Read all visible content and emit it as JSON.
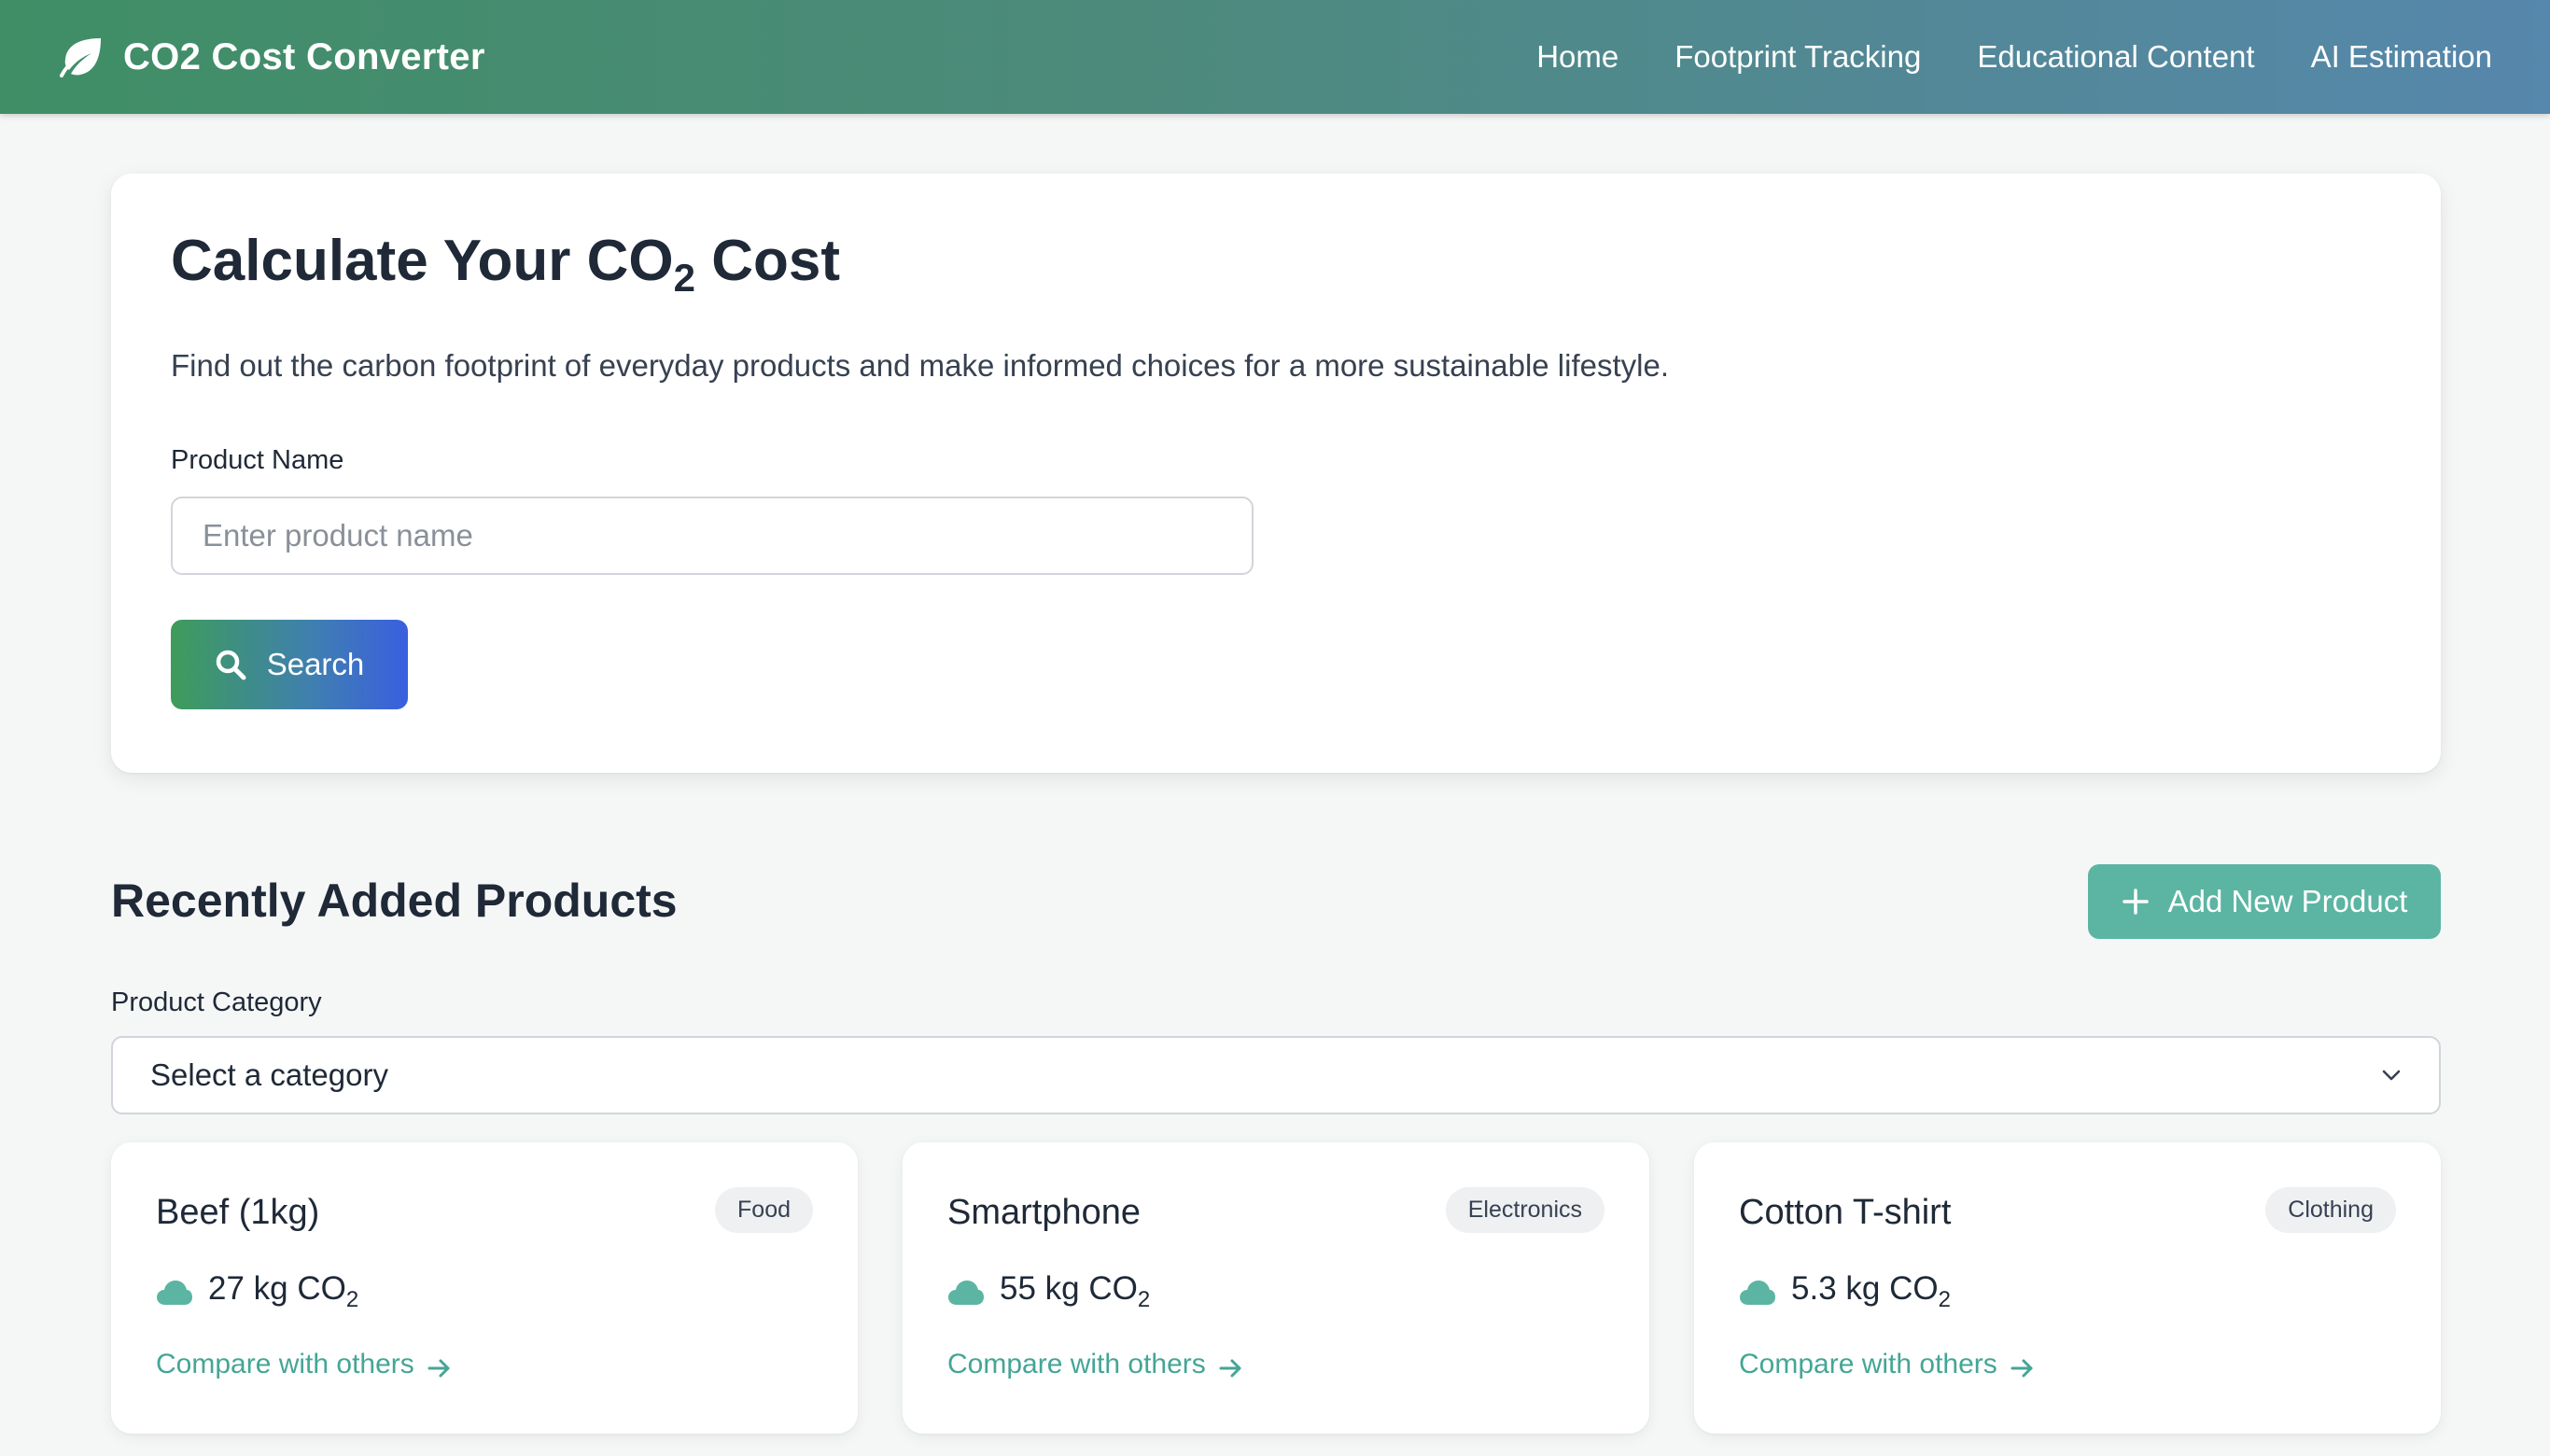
{
  "navbar": {
    "brand_title": "CO2 Cost Converter",
    "brand_icon": "leaf-icon",
    "links": [
      {
        "label": "Home"
      },
      {
        "label": "Footprint Tracking"
      },
      {
        "label": "Educational Content"
      },
      {
        "label": "AI Estimation"
      }
    ]
  },
  "calculator": {
    "title_prefix": "Calculate Your CO",
    "title_subscript": "2",
    "title_suffix": " Cost",
    "description": "Find out the carbon footprint of everyday products and make informed choices for a more sustainable lifestyle.",
    "product_label": "Product Name",
    "product_placeholder": "Enter product name",
    "product_value": "",
    "search_label": "Search",
    "search_icon": "search-icon"
  },
  "recent": {
    "title": "Recently Added Products",
    "add_button_label": "Add New Product",
    "add_icon": "plus-icon",
    "category_label": "Product Category",
    "category_selected": "Select a category",
    "products": [
      {
        "name": "Beef (1kg)",
        "category": "Food",
        "co2_prefix": "27 kg CO",
        "co2_sub": "2",
        "compare_label": "Compare with others"
      },
      {
        "name": "Smartphone",
        "category": "Electronics",
        "co2_prefix": "55 kg CO",
        "co2_sub": "2",
        "compare_label": "Compare with others"
      },
      {
        "name": "Cotton T-shirt",
        "category": "Clothing",
        "co2_prefix": "5.3 kg CO",
        "co2_sub": "2",
        "compare_label": "Compare with others"
      }
    ]
  },
  "colors": {
    "nav_gradient_start": "#3f8e66",
    "nav_gradient_end": "#5687ac",
    "accent_teal": "#5bb5a2",
    "link_teal": "#45a596",
    "search_gradient_start": "#3e9c5a",
    "search_gradient_end": "#3a5fe0",
    "background": "#f5f7f7"
  }
}
